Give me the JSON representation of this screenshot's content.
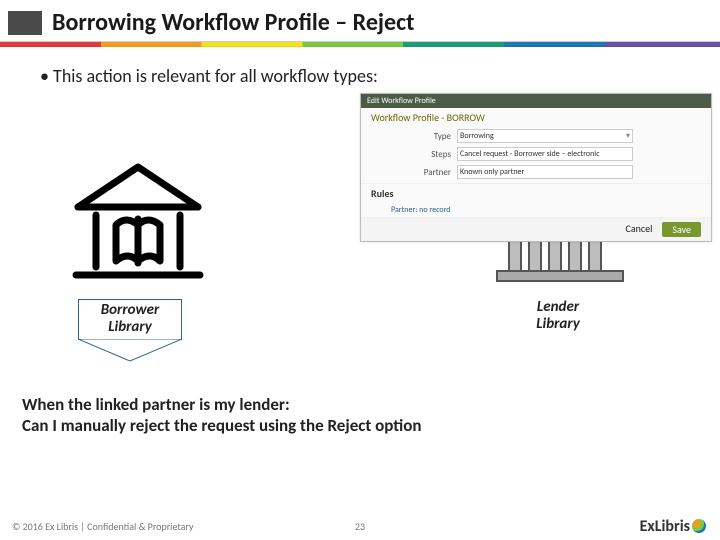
{
  "header": {
    "title": "Borrowing Workflow Profile – Reject"
  },
  "body": {
    "bullet1": "This action is relevant for all workflow types:",
    "borrower_label_l1": "Borrower",
    "borrower_label_l2": "Library",
    "lender_label_l1": "Lender",
    "lender_label_l2": "Library",
    "question_l1": "When the linked partner is my lender:",
    "question_l2": "Can I manually reject the request using the Reject option"
  },
  "profile_panel": {
    "breadcrumb": "Edit Workflow Profile",
    "subtitle": "Workflow Profile - BORROW",
    "type_label": "Type",
    "type_value": "Borrowing",
    "steps_label": "Steps",
    "steps_value": "Cancel request - Borrower side – electronic",
    "partner_label": "Partner",
    "partner_value": "Known only partner",
    "rules_header": "Rules",
    "rules_link": "Partner: no record",
    "cancel": "Cancel",
    "save": "Save"
  },
  "footer": {
    "copyright": "© 2016 Ex Libris | Confidential & Proprietary",
    "page": "23",
    "brand": "ExLibris"
  }
}
